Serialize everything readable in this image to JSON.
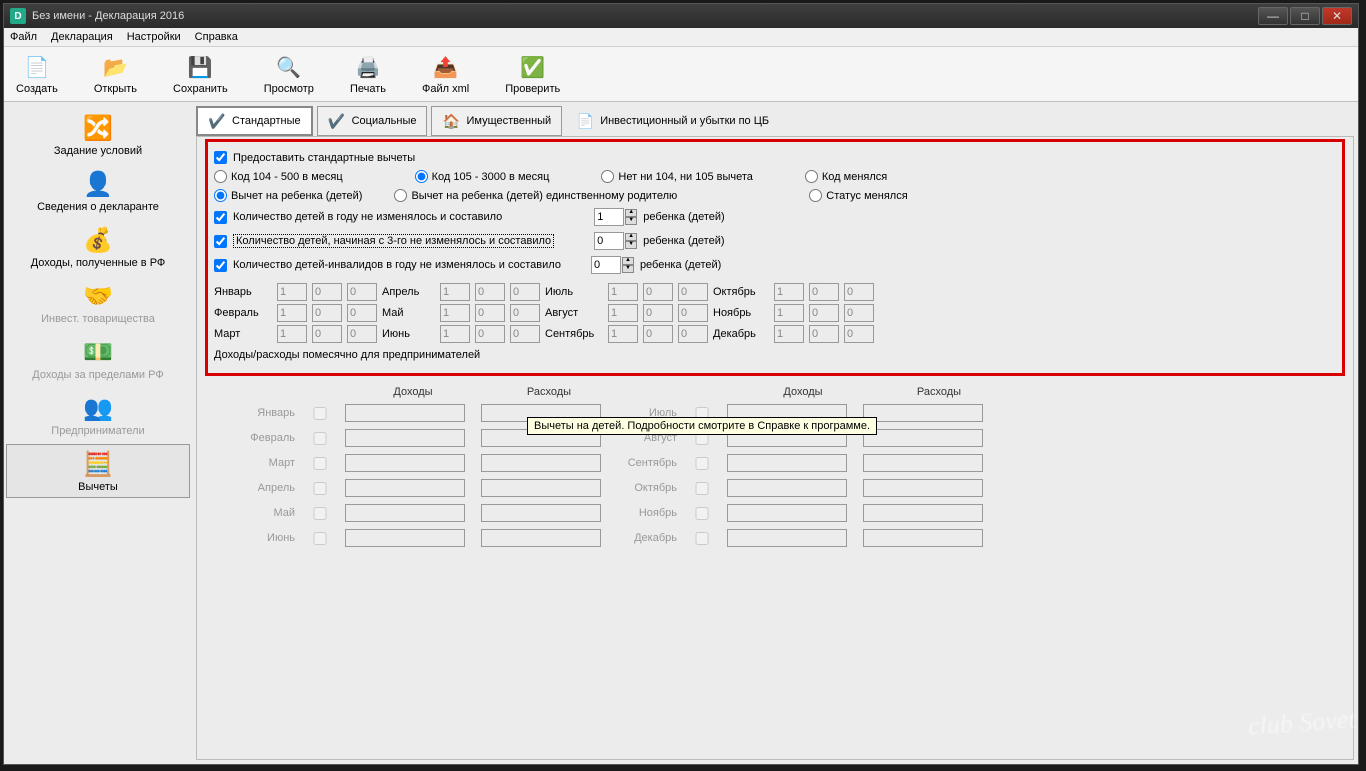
{
  "window": {
    "title": "Без имени - Декларация 2016"
  },
  "menubar": {
    "file": "Файл",
    "declaration": "Декларация",
    "settings": "Настройки",
    "help": "Справка"
  },
  "toolbar": {
    "create": "Создать",
    "open": "Открыть",
    "save": "Сохранить",
    "preview": "Просмотр",
    "print": "Печать",
    "xml": "Файл xml",
    "check": "Проверить"
  },
  "sidebar": {
    "conditions": "Задание условий",
    "declarant": "Сведения о декларанте",
    "income_rf": "Доходы, полученные в РФ",
    "invest": "Инвест. товарищества",
    "income_abroad": "Доходы за пределами РФ",
    "entrepreneurs": "Предприниматели",
    "deductions": "Вычеты"
  },
  "tabs": {
    "standard": "Стандартные",
    "social": "Социальные",
    "property": "Имущественный",
    "invest_cb": "Инвестиционный и убытки по ЦБ"
  },
  "form": {
    "checkbox": "Предоставить стандартные вычеты",
    "r_code104": "Код 104 - 500 в месяц",
    "r_code105": "Код 105 - 3000 в месяц",
    "r_none": "Нет ни 104, ни 105 вычета",
    "r_code_changed": "Код менялся",
    "r_child": "Вычет на ребенка (детей)",
    "r_child_single": "Вычет на ребенка (детей) единственному родителю",
    "r_status_changed": "Статус менялся",
    "kids_count": "Количество детей в году не изменялось и составило",
    "kids_from3": "Количество детей, начиная с 3-го не изменялось и составило",
    "kids_disabled": "Количество детей-инвалидов в году не изменялось и составило",
    "kids_unit": "ребенка (детей)",
    "val1": "1",
    "val0": "0",
    "m1": "Январь",
    "m2": "Февраль",
    "m3": "Март",
    "m4": "Апрель",
    "m5": "Май",
    "m6": "Июнь",
    "m7": "Июль",
    "m8": "Август",
    "m9": "Сентябрь",
    "m10": "Октябрь",
    "m11": "Ноябрь",
    "m12": "Декабрь",
    "biz_title": "Доходы/расходы помесячно для предпринимателей",
    "income": "Доходы",
    "expense": "Расходы",
    "tooltip": "Вычеты на детей. Подробности смотрите в Справке к программе."
  },
  "watermark": "club Sovet"
}
